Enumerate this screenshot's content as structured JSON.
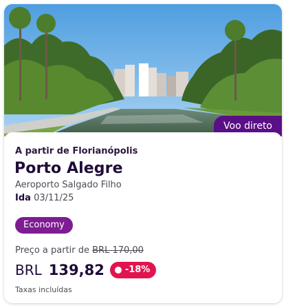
{
  "card": {
    "badge": "Voo direto",
    "origin_text": "A partir de Florianópolis",
    "destination": "Porto Alegre",
    "airport": "Aeroporto Salgado Filho",
    "trip_label": "Ida",
    "trip_date": "03/11/25",
    "cabin_class": "Economy",
    "price_from_label": "Preço a partir de",
    "old_price": "BRL 170,00",
    "currency": "BRL",
    "price": "139,82",
    "discount": "-18%",
    "taxes_note": "Taxas incluídas"
  },
  "colors": {
    "brand_purple": "#5b0f86",
    "chip_purple": "#7e1d92",
    "discount_red": "#e1144f",
    "text_dark": "#1f0c3a"
  },
  "image": {
    "alt": "Park with palm trees, pond and city skyline"
  }
}
